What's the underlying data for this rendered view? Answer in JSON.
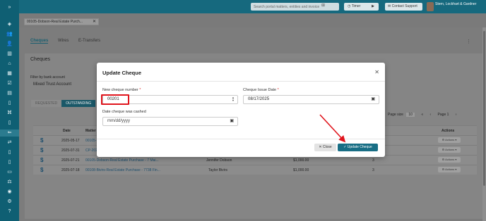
{
  "sidebar": {
    "collapse_glyph": "»",
    "items": [
      {
        "icon": "cube-icon",
        "glyph": "◈"
      },
      {
        "icon": "users-icon",
        "glyph": "👥"
      },
      {
        "icon": "user-icon",
        "glyph": "👤"
      },
      {
        "icon": "building-icon",
        "glyph": "▥"
      },
      {
        "icon": "home-icon",
        "glyph": "⌂"
      },
      {
        "icon": "calendar-icon",
        "glyph": "▦"
      },
      {
        "icon": "checklist-icon",
        "glyph": "☑"
      },
      {
        "icon": "chart-icon",
        "glyph": "▤"
      },
      {
        "icon": "document-icon",
        "glyph": "▯"
      },
      {
        "icon": "bank-icon",
        "glyph": "⌘"
      },
      {
        "icon": "file-icon",
        "glyph": "▯"
      },
      {
        "icon": "arrow-right-icon",
        "glyph": "→"
      },
      {
        "icon": "back-arrow-icon",
        "glyph": "⇐"
      },
      {
        "icon": "transfer-icon",
        "glyph": "⇄"
      },
      {
        "icon": "page-icon",
        "glyph": "▯"
      },
      {
        "icon": "receipt-icon",
        "glyph": "▯"
      },
      {
        "icon": "money-icon",
        "glyph": "▭"
      },
      {
        "icon": "scale-icon",
        "glyph": "⚖"
      },
      {
        "icon": "profile-icon",
        "glyph": "◉"
      },
      {
        "icon": "settings-icon",
        "glyph": "⚙"
      },
      {
        "icon": "help-icon",
        "glyph": "?"
      }
    ]
  },
  "topbar": {
    "search_placeholder": "Search portal matters, entities and invoice",
    "search_icon": "⊞",
    "search_dropdown": "▾",
    "timer_label": "Timer",
    "timer_icon": "◷",
    "play_icon": "▶",
    "contact_label": "Contact Support",
    "contact_icon": "✉",
    "firm_name": "Stern, Lockhart & Gardner"
  },
  "file_tab": {
    "label": "00105-Dobson-Real Estate Purch...",
    "close": "✕"
  },
  "subtabs": [
    "Cheques",
    "Wires",
    "E-Transfers"
  ],
  "subtabs_more": "⋮",
  "cheques": {
    "title": "Cheques",
    "filter_label": "Filter by bank account",
    "filter_value": "Mixed Trust Account",
    "status_tabs": [
      "REQUESTED",
      "OUTSTANDING"
    ],
    "page_size_label": "Page size",
    "page_size_value": "10",
    "page_label": "Page 1",
    "pager_first": "«",
    "pager_prev": "‹",
    "pager_next": "›",
    "pager_last": "»",
    "columns": [
      "Date",
      "Matter",
      "Actions"
    ],
    "rows": [
      {
        "date": "2025-05-17",
        "matter": "00105-D...",
        "payee": "",
        "amount": "",
        "number": "",
        "actions": "⚙ Actions ▾"
      },
      {
        "date": "2025-07-31",
        "matter": "CP-202...",
        "payee": "",
        "amount": "",
        "number": "",
        "actions": "⚙ Actions ▾"
      },
      {
        "date": "2025-07-21",
        "matter": "00105-Dobson-Real Estate Purchase - 7 Mai...",
        "payee": "Jennifer Dobson",
        "amount": "$1,000.00",
        "number": "3",
        "actions": "⚙ Actions ▾"
      },
      {
        "date": "2025-07-18",
        "matter": "00108-Bivirs-Real Estate Purchase - 7738 Fin...",
        "payee": "Taylor Bivirs",
        "amount": "$1,000.00",
        "number": "3",
        "actions": "⚙ Actions ▾"
      }
    ],
    "row_icon": "$"
  },
  "modal": {
    "title": "Update Cheque",
    "close_glyph": "✕",
    "cheque_number_label": "New cheque number",
    "cheque_number_value": "00201",
    "required_mark": "*",
    "spinner_up": "▲",
    "spinner_down": "▼",
    "issue_date_label": "Cheque Issue Date",
    "issue_date_value": "08/17/2025",
    "cashed_label": "Date cheque was cashed",
    "cashed_value": "mm/dd/yyyy",
    "calendar_glyph": "▣",
    "close_button": "✕ Close",
    "update_button": "✓ Update Cheque"
  },
  "colors": {
    "sidebar": "#0f5f73",
    "accent": "#186e85",
    "highlight": "#e0141c"
  }
}
